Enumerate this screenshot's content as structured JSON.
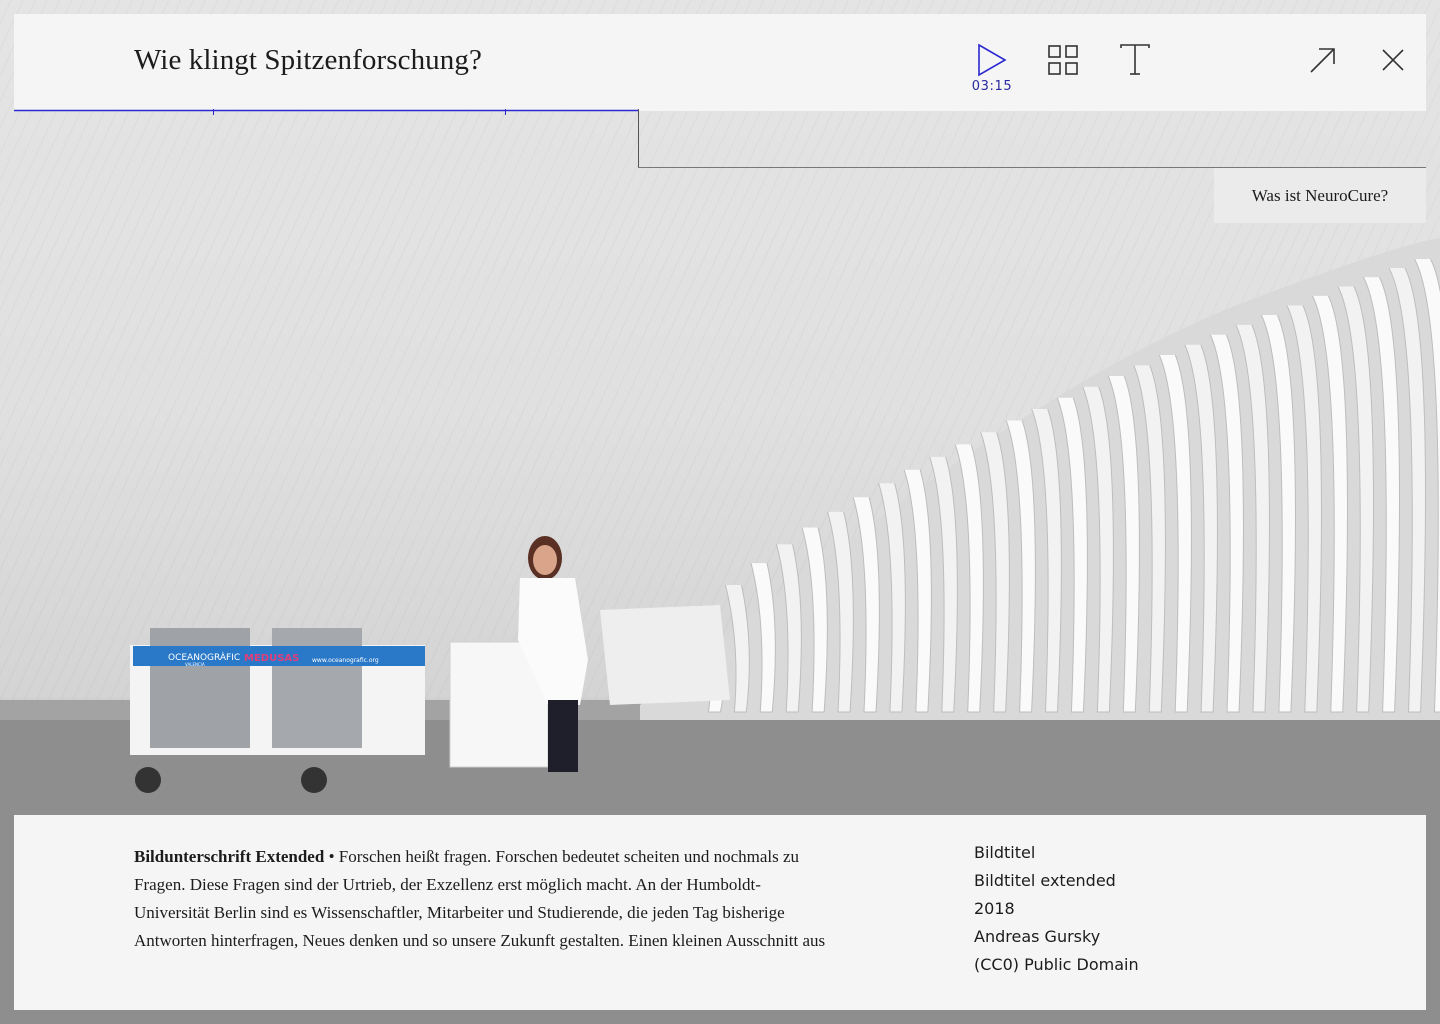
{
  "header": {
    "title": "Wie klingt Spitzenforschung?",
    "play_time": "03:15",
    "accent_color": "#2a2ad0"
  },
  "icons": {
    "play": "play-icon",
    "grid": "grid-icon",
    "text": "text-size-icon",
    "expand": "arrow-up-right-icon",
    "close": "close-icon"
  },
  "side_link": {
    "label": "Was ist NeuroCure?"
  },
  "caption": {
    "lead": "Bildunterschrift Extended",
    "bullet": " • ",
    "body": "Forschen heißt fragen. Forschen bedeutet scheiten und nochmals zu Fragen. Diese Fragen sind der Urtrieb, der Exzellenz erst möglich macht. An der Humboldt-Universität Berlin sind es Wissenschaftler, Mitarbeiter und Studierende, die jeden Tag bisherige Antworten hinterfragen, Neues denken und so unsere Zukunft gestalten. Einen kleinen Ausschnitt aus"
  },
  "meta": {
    "title": "Bildtitel",
    "title_extended": "Bildtitel extended",
    "year": "2018",
    "author": "Andreas Gursky",
    "license": "(CC0) Public Domain"
  },
  "photo": {
    "cart_sign_brand": "OCEANOGRÀFIC",
    "cart_sign_city": "VALENCIA",
    "cart_sign_product": "MEDUSAS",
    "cart_sign_url": "www.oceanografic.org"
  }
}
